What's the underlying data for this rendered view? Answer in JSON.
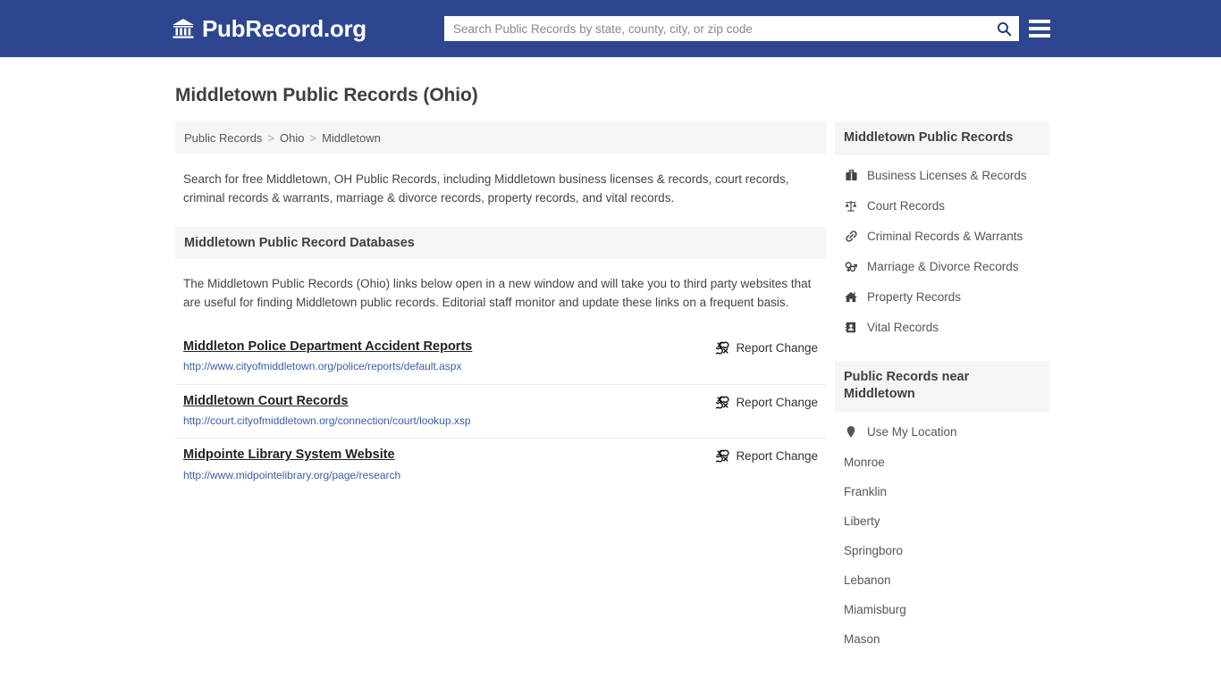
{
  "header": {
    "brand_icon": "bank-building-icon",
    "brand_text": "PubRecord.org",
    "search_placeholder": "Search Public Records by state, county, city, or zip code",
    "search_value": "",
    "search_icon": "search-icon",
    "menu_icon": "hamburger-menu-icon",
    "background_color": "#2d468f"
  },
  "main": {
    "page_title": "Middletown Public Records (Ohio)",
    "breadcrumb": {
      "items": [
        "Public Records",
        "Ohio",
        "Middletown"
      ],
      "separator": ">"
    },
    "lead_text": "Search for free Middletown, OH Public Records, including Middletown business licenses & records, court records, criminal records & warrants, marriage & divorce records, property records, and vital records.",
    "section_heading": "Middletown Public Record Databases",
    "section_text": "The Middletown Public Records (Ohio) links below open in a new window and will take you to third party websites that are useful for finding Middletown public records. Editorial staff monitor and update these links on a frequent basis.",
    "report_change_label": "Report Change",
    "report_change_icon": "unlink-icon",
    "links": [
      {
        "title": "Middleton Police Department Accident Reports",
        "url": "http://www.cityofmiddletown.org/police/reports/default.aspx"
      },
      {
        "title": "Middletown Court Records",
        "url": "http://court.cityofmiddletown.org/connection/court/lookup.xsp"
      },
      {
        "title": "Midpointe Library System Website",
        "url": "http://www.midpointelibrary.org/page/research"
      }
    ]
  },
  "sidebar": {
    "records_panel": {
      "heading": "Middletown Public Records",
      "items": [
        {
          "label": "Business Licenses & Records",
          "icon": "briefcase-icon"
        },
        {
          "label": "Court Records",
          "icon": "scales-of-justice-icon"
        },
        {
          "label": "Criminal Records & Warrants",
          "icon": "chain-link-icon"
        },
        {
          "label": "Marriage & Divorce Records",
          "icon": "gender-symbols-icon"
        },
        {
          "label": "Property Records",
          "icon": "home-icon"
        },
        {
          "label": "Vital Records",
          "icon": "id-card-icon"
        }
      ]
    },
    "nearby_panel": {
      "heading": "Public Records near Middletown",
      "location_item": {
        "label": "Use My Location",
        "icon": "map-pin-icon"
      },
      "cities": [
        "Monroe",
        "Franklin",
        "Liberty",
        "Springboro",
        "Lebanon",
        "Miamisburg",
        "Mason"
      ]
    }
  },
  "colors": {
    "brand_blue": "#2d468f",
    "panel_gray": "#f5f5f5",
    "link_blue": "#3a5fa8",
    "body_text": "#444444"
  }
}
